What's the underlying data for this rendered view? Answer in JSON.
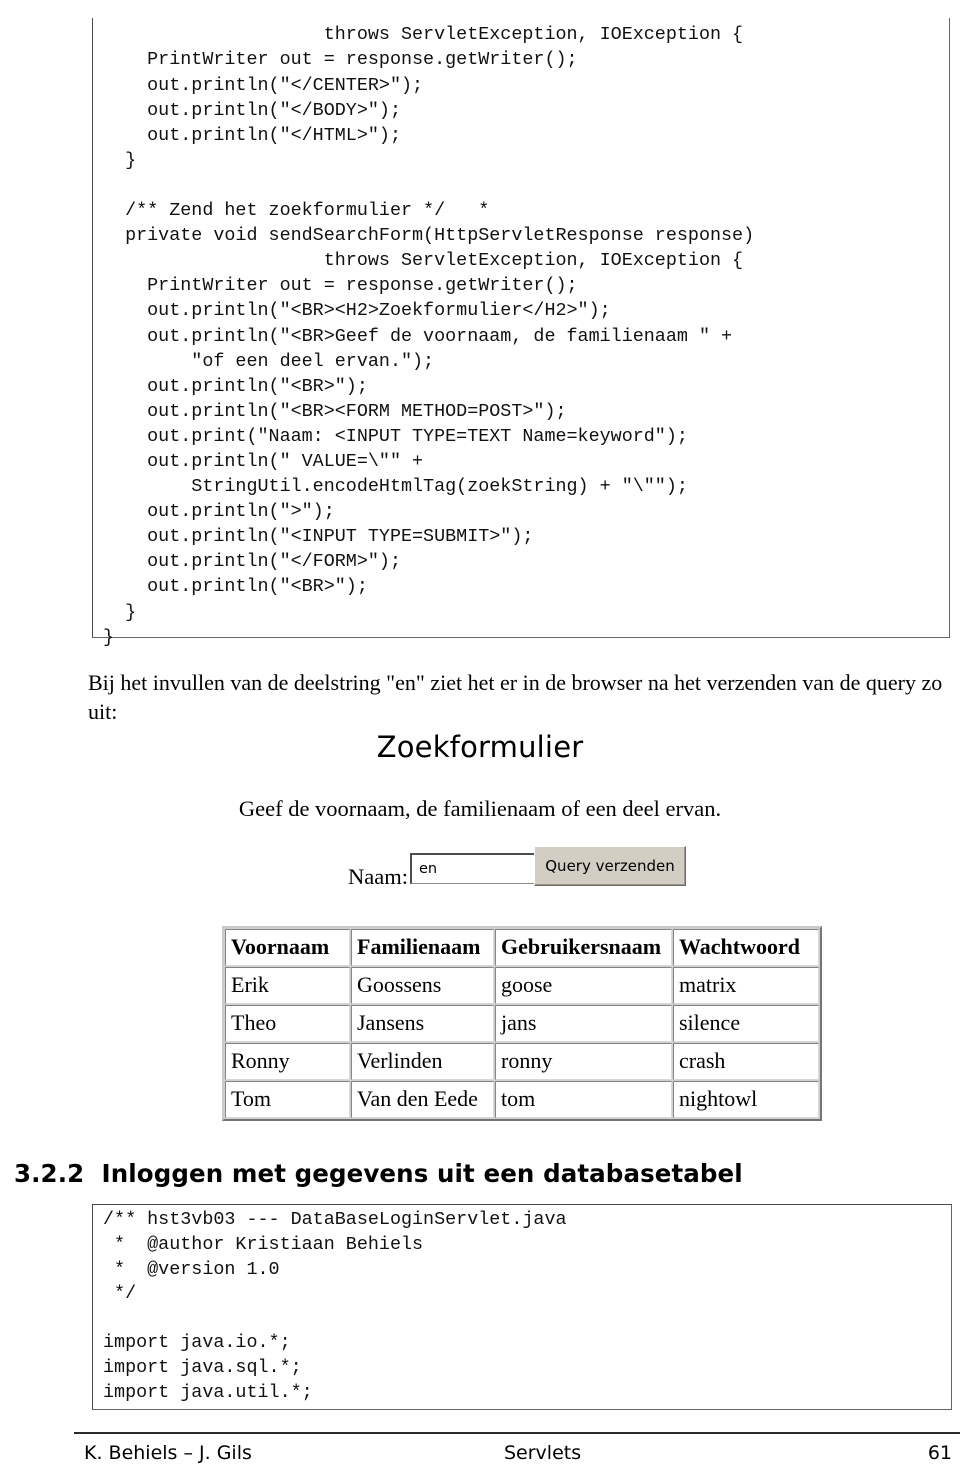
{
  "code_top": "                    throws ServletException, IOException {\n    PrintWriter out = response.getWriter();\n    out.println(\"</CENTER>\");\n    out.println(\"</BODY>\");\n    out.println(\"</HTML>\");\n  }\n\n  /** Zend het zoekformulier */   *\n  private void sendSearchForm(HttpServletResponse response)\n                    throws ServletException, IOException {\n    PrintWriter out = response.getWriter();\n    out.println(\"<BR><H2>Zoekformulier</H2>\");\n    out.println(\"<BR>Geef de voornaam, de familienaam \" +\n        \"of een deel ervan.\");\n    out.println(\"<BR>\");\n    out.println(\"<BR><FORM METHOD=POST>\");\n    out.print(\"Naam: <INPUT TYPE=TEXT Name=keyword\");\n    out.println(\" VALUE=\\\"\" +\n        StringUtil.encodeHtmlTag(zoekString) + \"\\\"\");\n    out.println(\">\");\n    out.println(\"<INPUT TYPE=SUBMIT>\");\n    out.println(\"</FORM>\");\n    out.println(\"<BR>\");\n  }\n}",
  "intro_paragraph": "Bij het invullen van de deelstring \"en\" ziet het er in de browser na het verzenden van de query zo uit:",
  "browser_mock": {
    "title": "Zoekformulier",
    "instruction": "Geef de voornaam, de familienaam of een deel ervan.",
    "naam_label": "Naam:",
    "keyword_value": "en",
    "keyword_placeholder": "",
    "submit_label": "Query verzenden"
  },
  "results_table": {
    "headers": [
      "Voornaam",
      "Familienaam",
      "Gebruikersnaam",
      "Wachtwoord"
    ],
    "rows": [
      [
        "Erik",
        "Goossens",
        "goose",
        "matrix"
      ],
      [
        "Theo",
        "Jansens",
        "jans",
        "silence"
      ],
      [
        "Ronny",
        "Verlinden",
        "ronny",
        "crash"
      ],
      [
        "Tom",
        "Van den Eede",
        "tom",
        "nightowl"
      ]
    ]
  },
  "section_heading": "3.2.2  Inloggen met gegevens uit een databasetabel",
  "code_bottom": "/** hst3vb03 --- DataBaseLoginServlet.java\n *  @author Kristiaan Behiels\n *  @version 1.0\n */\n\nimport java.io.*;\nimport java.sql.*;\nimport java.util.*;",
  "footer": {
    "authors": "K. Behiels – J. Gils",
    "center": "Servlets",
    "page": "61"
  }
}
